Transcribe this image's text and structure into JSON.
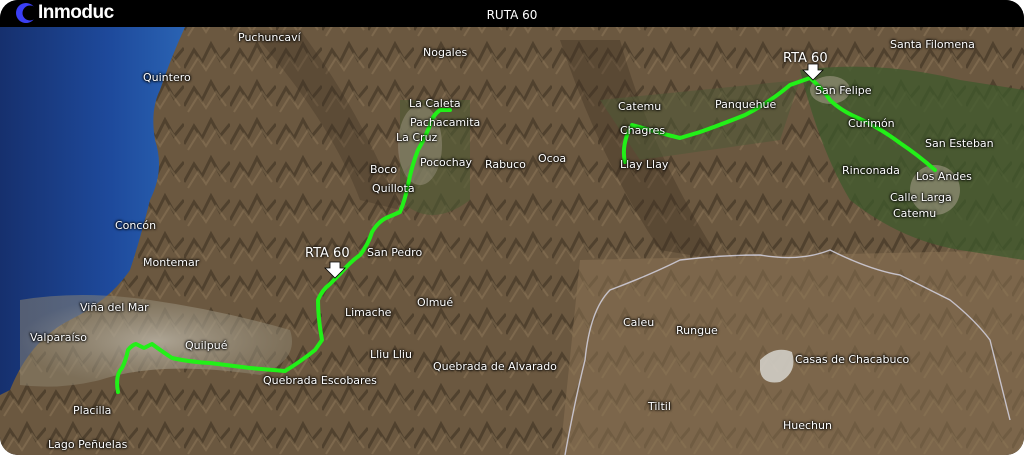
{
  "header": {
    "logo_text": "Inmoduc",
    "title": "RUTA 60"
  },
  "colors": {
    "route": "#22f018",
    "sea": "#1e4a9c",
    "terrain": "#6b5840",
    "urban": "#a9a294",
    "logo_accent": "#3b3ff5"
  },
  "markers": [
    {
      "label": "RTA 60"
    },
    {
      "label": "RTA 60"
    }
  ],
  "places": [
    "Puchuncaví",
    "Nogales",
    "Quintero",
    "La Caleta",
    "Pachacamita",
    "La Cruz",
    "Pocochay",
    "Boco",
    "Quillota",
    "Rabuco",
    "Ocoa",
    "Catemu",
    "Chagres",
    "Llay Llay",
    "Panquehue",
    "San Felipe",
    "Santa Filomena",
    "Curimón",
    "San Esteban",
    "Rinconada",
    "Los Andes",
    "Calle Larga",
    "Catemu",
    "Concón",
    "Montemar",
    "San Pedro",
    "Viña del Mar",
    "Limache",
    "Olmué",
    "Valparaíso",
    "Quilpué",
    "Lliu Lliu",
    "Quebrada de Alvarado",
    "Quebrada Escobares",
    "Placilla",
    "Lago Peñuelas",
    "Caleu",
    "Rungue",
    "Casas de Chacabuco",
    "Tiltil",
    "Huechun"
  ]
}
